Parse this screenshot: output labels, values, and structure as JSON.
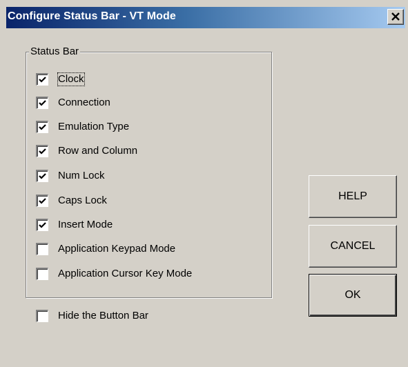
{
  "window": {
    "title": "Configure Status Bar - VT Mode",
    "close_label": "close"
  },
  "status_group": {
    "label": "Status Bar",
    "options": [
      {
        "label": "Clock",
        "checked": true
      },
      {
        "label": "Connection",
        "checked": true
      },
      {
        "label": "Emulation Type",
        "checked": true
      },
      {
        "label": "Row and Column",
        "checked": true
      },
      {
        "label": "Num Lock",
        "checked": true
      },
      {
        "label": "Caps Lock",
        "checked": true
      },
      {
        "label": "Insert Mode",
        "checked": true
      },
      {
        "label": "Application Keypad Mode",
        "checked": false
      },
      {
        "label": "Application Cursor Key Mode",
        "checked": false
      }
    ]
  },
  "hide_button_bar": {
    "label": "Hide the Button Bar",
    "checked": false
  },
  "buttons": {
    "help": "HELP",
    "cancel": "CANCEL",
    "ok": "OK"
  },
  "colors": {
    "face": "#d4d0c8",
    "title_start": "#0a246a",
    "title_end": "#a6caf0"
  },
  "icons": {
    "close": "close-icon",
    "check": "checkmark-icon"
  }
}
